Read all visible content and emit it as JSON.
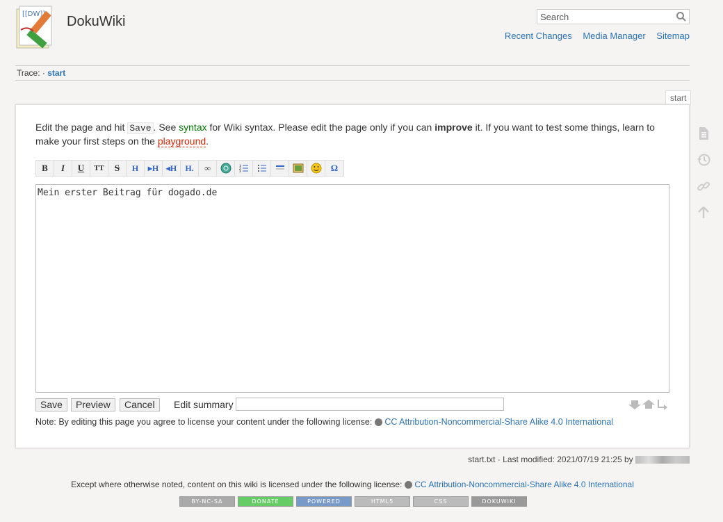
{
  "header": {
    "logo_text": "[[DW]]",
    "site_title": "DokuWiki",
    "search_placeholder": "Search",
    "tools": [
      "Recent Changes",
      "Media Manager",
      "Sitemap"
    ]
  },
  "trace": {
    "label": "Trace:",
    "separator": "·",
    "crumb": "start"
  },
  "page_tab": "start",
  "intro": {
    "t1": "Edit the page and hit ",
    "save_code": "Save",
    "t2": ". See ",
    "syntax_link": "syntax",
    "t3": " for Wiki syntax. Please edit the page only if you can ",
    "improve": "improve",
    "t4": " it. If you want to test some things, learn to make your first steps on the ",
    "playground_link": "playground",
    "t5": "."
  },
  "toolbar_icons": [
    "bold-icon",
    "italic-icon",
    "underline-icon",
    "monospace-icon",
    "strikethrough-icon",
    "heading-same-icon",
    "heading-lower-icon",
    "heading-higher-icon",
    "heading-select-icon",
    "link-icon",
    "external-link-icon",
    "ordered-list-icon",
    "unordered-list-icon",
    "horizontal-rule-icon",
    "media-icon",
    "smiley-icon",
    "special-chars-icon"
  ],
  "editor": {
    "content": "Mein erster Beitrag für dogado.de"
  },
  "buttons": {
    "save": "Save",
    "preview": "Preview",
    "cancel": "Cancel"
  },
  "summary": {
    "label": "Edit summary",
    "value": ""
  },
  "license_note": {
    "text": "Note: By editing this page you agree to license your content under the following license:",
    "link": "CC Attribution-Noncommercial-Share Alike 4.0 International"
  },
  "page_tools": [
    "show-page-icon",
    "old-revisions-icon",
    "backlinks-icon",
    "back-to-top-icon"
  ],
  "docinfo": {
    "text": "start.txt · Last modified: 2021/07/19 21:25 by"
  },
  "footer": {
    "text": "Except where otherwise noted, content on this wiki is licensed under the following license:",
    "link": "CC Attribution-Noncommercial-Share Alike 4.0 International",
    "badges": [
      "BY-NC-SA",
      "DONATE",
      "POWERED",
      "HTML5",
      "CSS",
      "DOKUWIKI"
    ]
  },
  "colors": {
    "link": "#2b73b7",
    "syntax": "#007700",
    "playground": "#dd2200",
    "background": "#f5f4f2"
  }
}
